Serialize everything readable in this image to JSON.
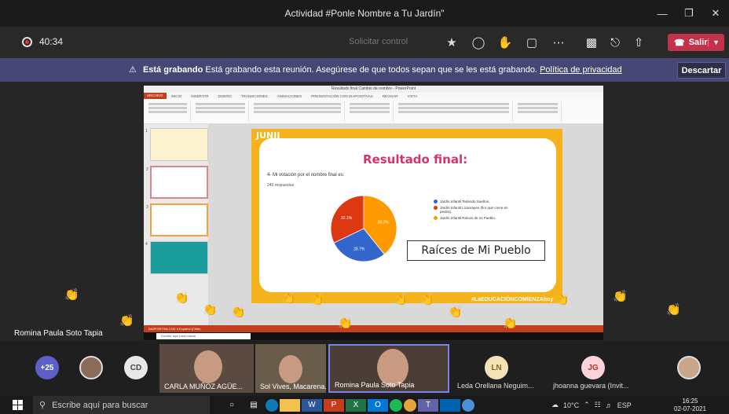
{
  "window": {
    "title": "Actividad #Ponle Nombre a Tu Jardín\"",
    "minimize": "—",
    "maximize": "❐",
    "close": "✕"
  },
  "toolbar": {
    "timer": "40:34",
    "request_control": "Solicitar control",
    "leave": "Salir"
  },
  "banner": {
    "bold": "Está grabando",
    "text": "Está grabando esta reunión. Asegúrese de que todos sepan que se les está grabando.",
    "link": "Política de privacidad",
    "dismiss": "Descartar"
  },
  "ppt": {
    "title": "Resultado final Cambio de nombre - PowerPoint",
    "tabs": [
      "ARCHIVO",
      "INICIO",
      "INSERTAR",
      "DISEÑO",
      "TRANSICIONES",
      "ANIMACIONES",
      "PRESENTACIÓN CON DIAPOSITIVAS",
      "REVISAR",
      "VISTA"
    ],
    "status": "DIAPOSITIVA 3 DE 4   Español (Chile)",
    "thumb_numbers": [
      "1",
      "2",
      "3",
      "4"
    ]
  },
  "slide": {
    "brand": "JUNJI",
    "title": "Resultado final:",
    "question": "4- Mi votación por el nombre final es:",
    "responses": "240 respuestas",
    "answer": "Raíces de Mi Pueblo",
    "slogan": "#LaEDUCACIÓNCOMIENZAhoy"
  },
  "chart_data": {
    "type": "pie",
    "title": "4- Mi votación por el nombre final es:",
    "categories": [
      "Jardín Infantil Tedendo Sueños.",
      "Jardín Infantil Licanrayen (flor que crece en piedra).",
      "Jardín Infantil Raíces de mi Pueblo."
    ],
    "values": [
      28.7,
      32.1,
      39.2
    ],
    "value_labels": [
      "28.7%",
      "32.1%",
      "39.2%"
    ],
    "colors": [
      "#3366cc",
      "#dc3912",
      "#ff9900"
    ],
    "legend": "right"
  },
  "inner_taskbar": {
    "search": "Escribe aquí para buscar"
  },
  "speaker": "Romina Paula Soto Tapia",
  "participants": {
    "overflow": "+25",
    "cd_initials": "CD",
    "ln_initials": "LN",
    "jg_initials": "JG",
    "videos": [
      {
        "name": "CARLA MUÑOZ AGÜE..."
      },
      {
        "name": "Sol Vives, Macarena..."
      },
      {
        "name": "Romina Paula Soto Tapia"
      }
    ],
    "ln_name": "Leda Orellana Neguim...",
    "jg_name": "jhoanna guevara (Invit..."
  },
  "taskbar": {
    "search": "Escribe aquí para buscar",
    "weather": "10°C",
    "lang": "ESP",
    "time": "16:25",
    "date": "02-07-2021"
  }
}
